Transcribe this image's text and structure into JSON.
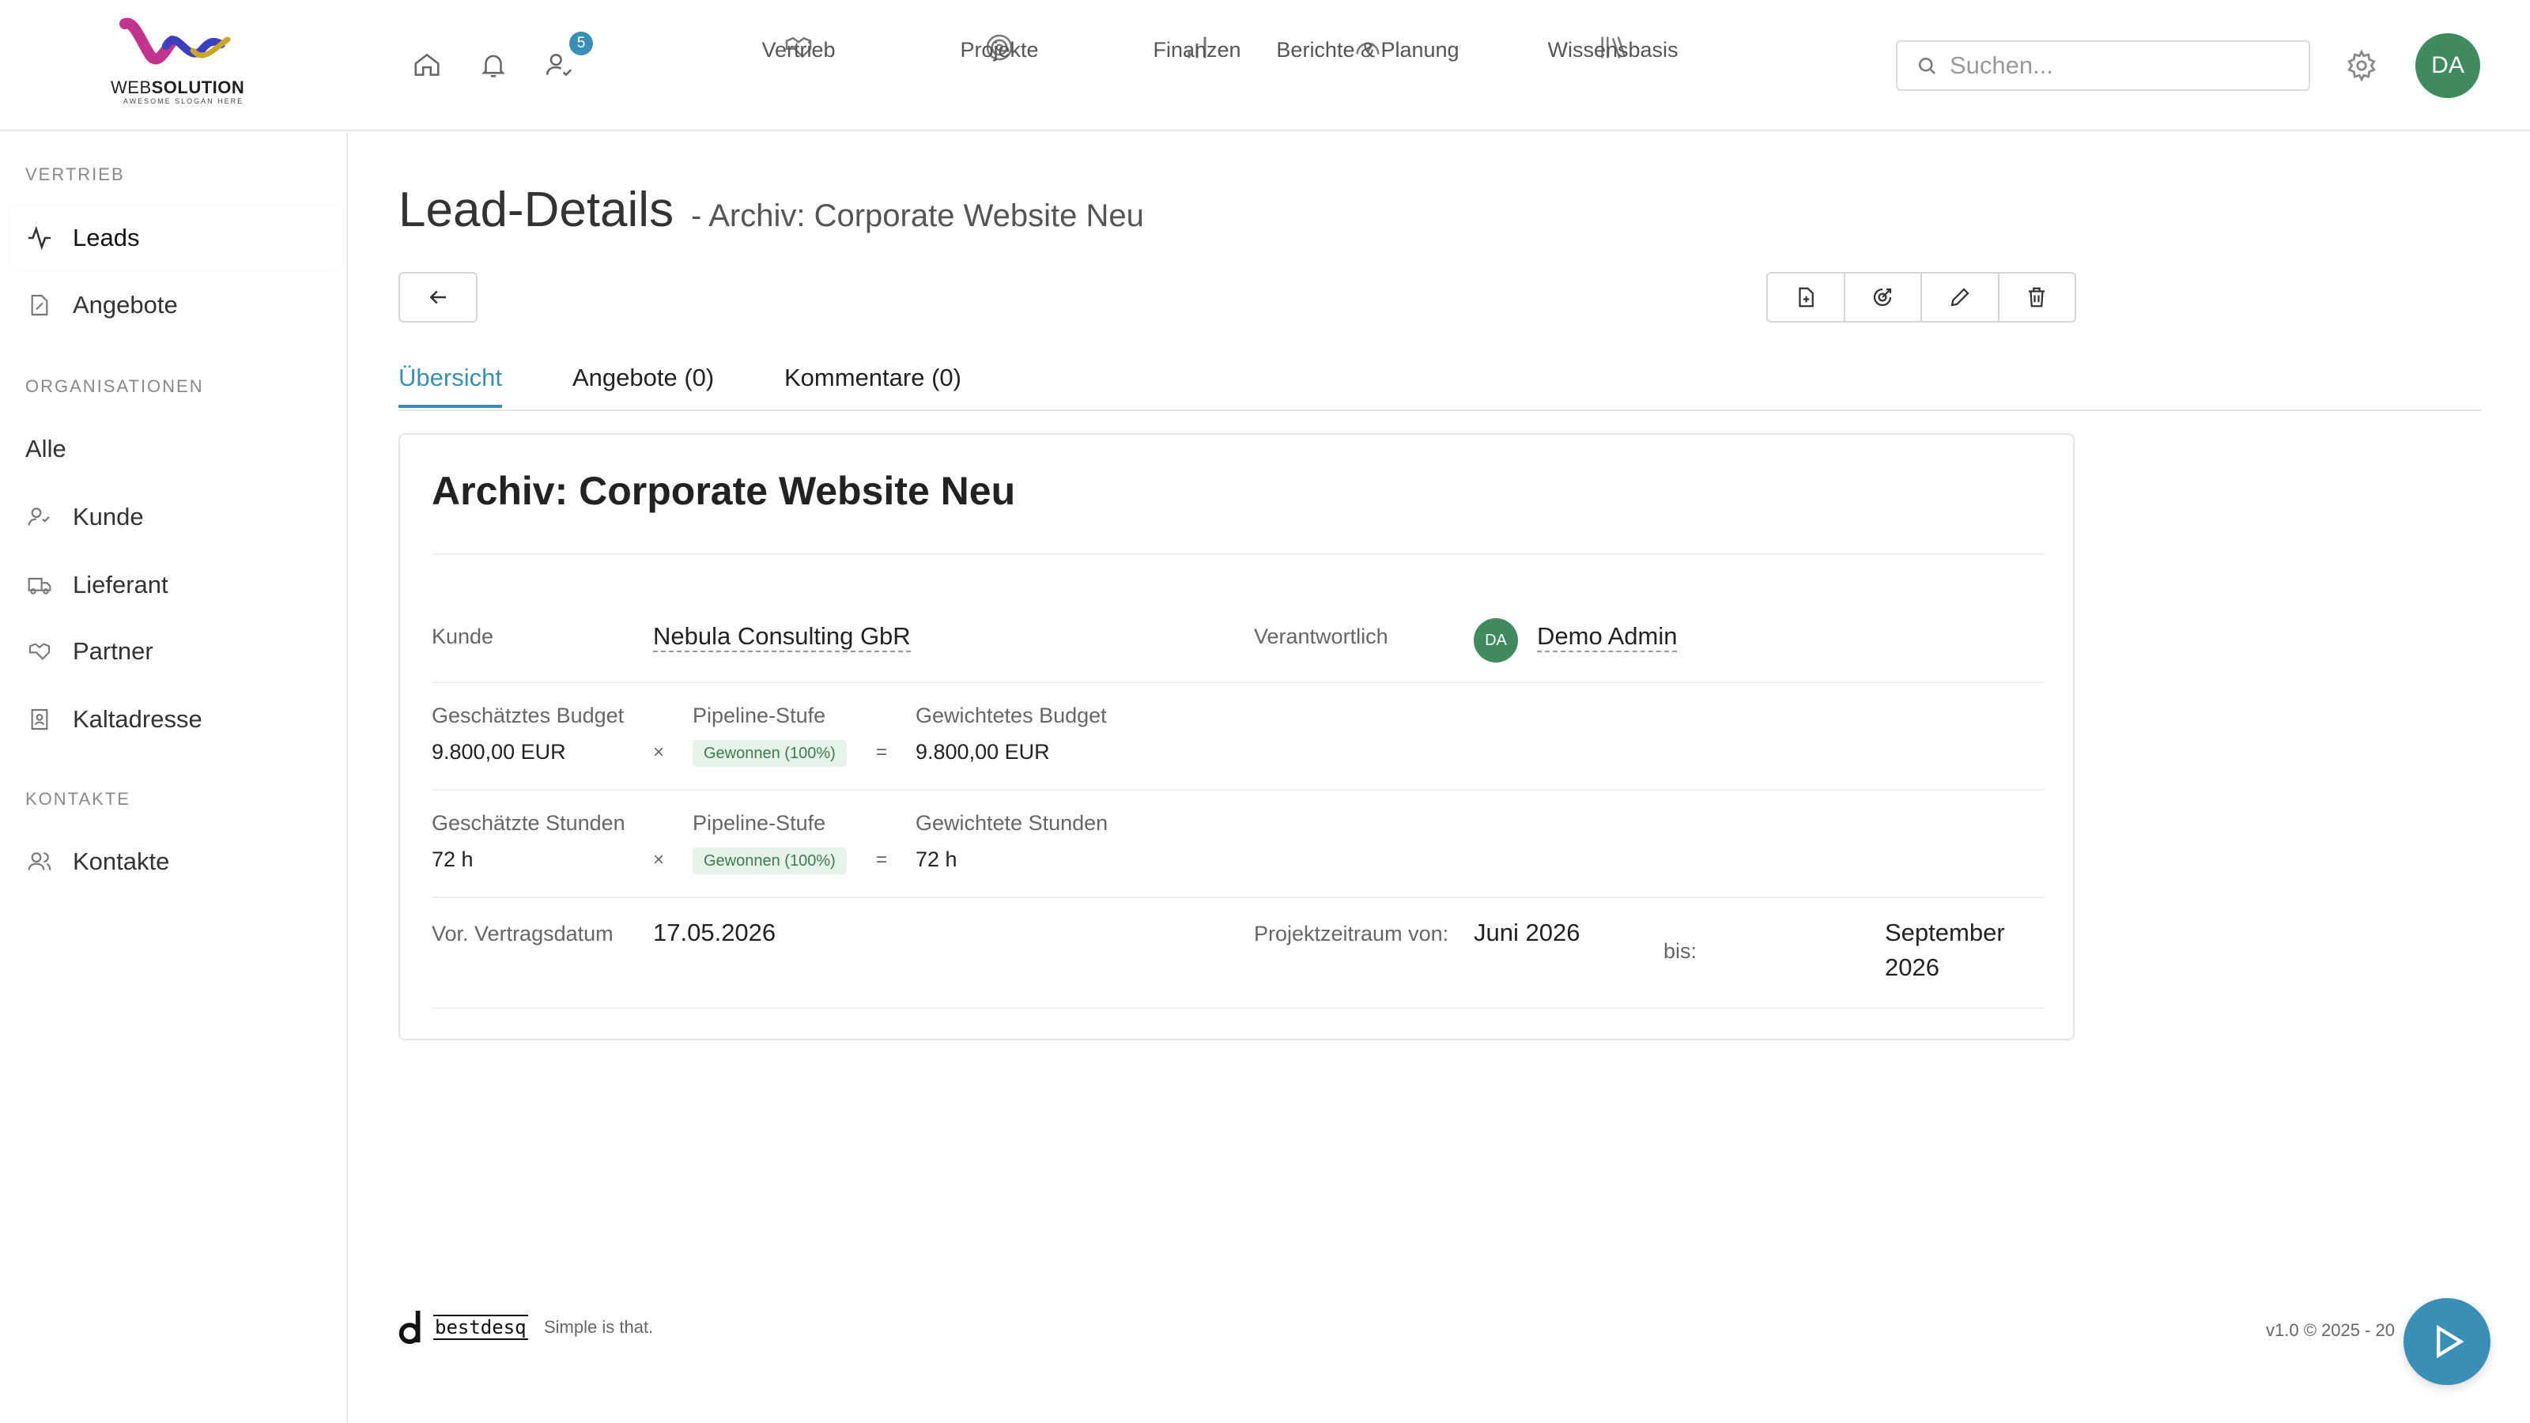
{
  "logo": {
    "text_bold_part": "SOLUTION",
    "text_light_part": "WEB",
    "tagline": "AWESOME SLOGAN HERE"
  },
  "quick_icons": {
    "notifications_badge": "5"
  },
  "mainnav": [
    {
      "label": "Vertrieb",
      "icon": "handshake-icon"
    },
    {
      "label": "Projekte",
      "icon": "target-icon"
    },
    {
      "label": "Finanzen",
      "icon": "bar-chart-icon"
    },
    {
      "label": "Berichte & Planung",
      "icon": "gauge-icon"
    },
    {
      "label": "Wissensbasis",
      "icon": "library-icon"
    }
  ],
  "search": {
    "placeholder": "Suchen..."
  },
  "user": {
    "initials": "DA"
  },
  "sidebar": {
    "sections": [
      {
        "title": "VERTRIEB",
        "items": [
          {
            "label": "Leads",
            "icon": "activity-icon",
            "active": true
          },
          {
            "label": "Angebote",
            "icon": "file-edit-icon"
          }
        ]
      },
      {
        "title": "ORGANISATIONEN",
        "items": [
          {
            "label": "Alle"
          },
          {
            "label": "Kunde",
            "icon": "user-check-icon"
          },
          {
            "label": "Lieferant",
            "icon": "truck-icon"
          },
          {
            "label": "Partner",
            "icon": "handshake-icon"
          },
          {
            "label": "Kaltadresse",
            "icon": "contact-book-icon"
          }
        ]
      },
      {
        "title": "KONTAKTE",
        "items": [
          {
            "label": "Kontakte",
            "icon": "users-icon"
          }
        ]
      }
    ]
  },
  "page": {
    "title": "Lead-Details",
    "subtitle": "- Archiv: Corporate Website Neu"
  },
  "tabs": [
    {
      "label": "Übersicht",
      "active": true
    },
    {
      "label": "Angebote (0)"
    },
    {
      "label": "Kommentare (0)"
    }
  ],
  "card": {
    "title": "Archiv: Corporate Website Neu",
    "kunde_label": "Kunde",
    "kunde_value": "Nebula Consulting GbR",
    "verantwortlich_label": "Verantwortlich",
    "verantwortlich_initials": "DA",
    "verantwortlich_value": "Demo Admin",
    "budget": {
      "label": "Geschätztes Budget",
      "value": "9.800,00 EUR",
      "times": "×",
      "stage_label": "Pipeline-Stufe",
      "stage_value": "Gewonnen (100%)",
      "equals": "=",
      "weighted_label": "Gewichtetes Budget",
      "weighted_value": "9.800,00 EUR"
    },
    "hours": {
      "label": "Geschätzte Stunden",
      "value": "72 h",
      "times": "×",
      "stage_label": "Pipeline-Stufe",
      "stage_value": "Gewonnen (100%)",
      "equals": "=",
      "weighted_label": "Gewichtete Stunden",
      "weighted_value": "72 h"
    },
    "contract_label": "Vor. Vertragsdatum",
    "contract_value": "17.05.2026",
    "period_from_label": "Projektzeitraum von:",
    "period_from_value": "Juni 2026",
    "period_to_label": "bis:",
    "period_to_value_line1": "September",
    "period_to_value_line2": "2026"
  },
  "footer": {
    "brand": "bestdesq",
    "tagline": "Simple is that.",
    "version": "v1.0 © 2025 - 20"
  },
  "colors": {
    "accent": "#3a8fb7",
    "avatar": "#3f8a5e",
    "pill_bg": "#e6f3e9",
    "pill_text": "#3f7a50"
  }
}
